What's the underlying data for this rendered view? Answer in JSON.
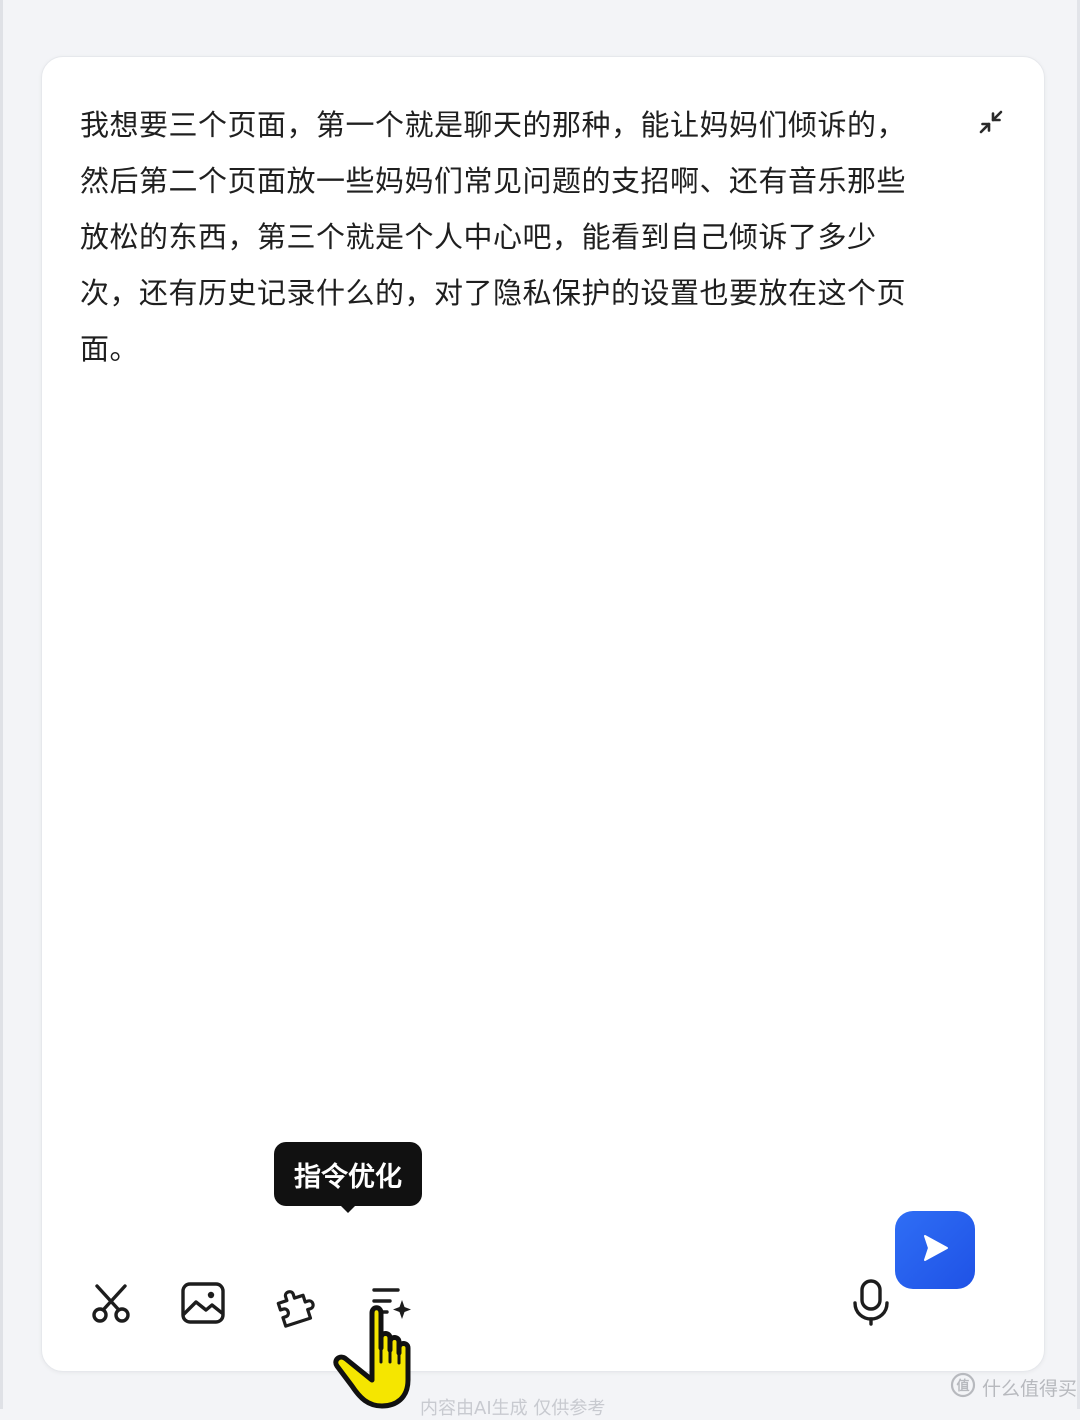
{
  "composer": {
    "prompt_text": "我想要三个页面，第一个就是聊天的那种，能让妈妈们倾诉的，然后第二个页面放一些妈妈们常见问题的支招啊、还有音乐那些放松的东西，第三个就是个人中心吧，能看到自己倾诉了多少次，还有历史记录什么的，对了隐私保护的设置也要放在这个页面。",
    "collapse_icon": "collapse-arrows-icon"
  },
  "toolbar": {
    "buttons": [
      {
        "icon": "scissors-icon"
      },
      {
        "icon": "image-icon"
      },
      {
        "icon": "plugin-icon"
      },
      {
        "icon": "prompt-optimize-icon"
      }
    ],
    "tooltip": "指令优化",
    "mic_icon": "microphone-icon",
    "send_icon": "send-icon",
    "accent_color": "#2563eb"
  },
  "footer": {
    "text": "内容由AI生成 仅供参考"
  },
  "watermark": {
    "icon": "zhi-logo-icon",
    "text": "什么值得买"
  }
}
